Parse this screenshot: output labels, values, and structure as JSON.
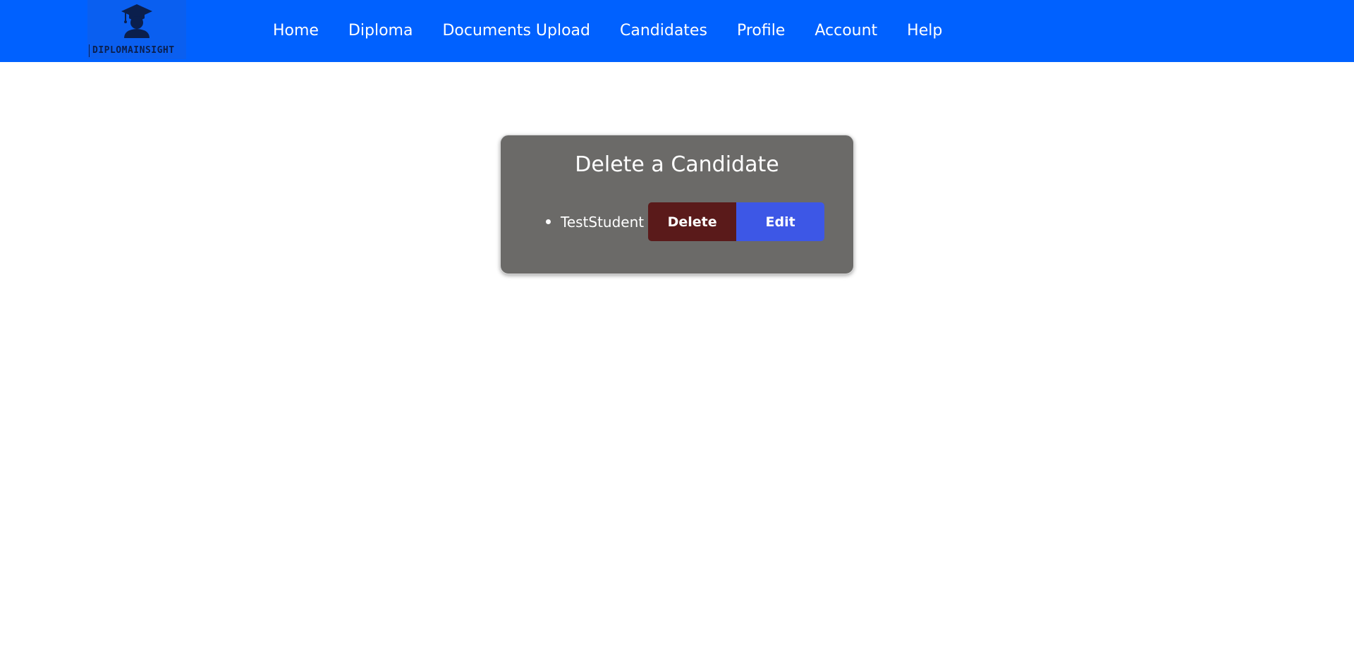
{
  "navbar": {
    "logo_text": "DIPLOMAINSIGHT",
    "links": [
      "Home",
      "Diploma",
      "Documents Upload",
      "Candidates",
      "Profile",
      "Account",
      "Help"
    ]
  },
  "card": {
    "title": "Delete a Candidate",
    "candidates": [
      {
        "name": "TestStudent",
        "delete_label": "Delete",
        "edit_label": "Edit"
      }
    ]
  },
  "colors": {
    "navbar": "#0061ff",
    "card": "#6b6a68",
    "delete_button": "#5a1a1a",
    "edit_button": "#3d57e6"
  }
}
